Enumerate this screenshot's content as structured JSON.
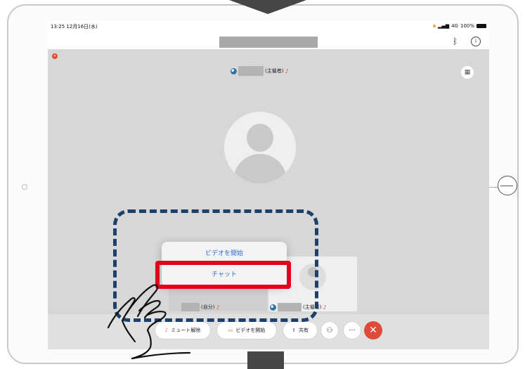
{
  "status_bar": {
    "time": "13:25",
    "date": "12月16日(水)",
    "network": "4G",
    "battery": "100%"
  },
  "top_bar": {
    "bluetooth_icon": "bluetooth-icon",
    "info_icon": "info-icon"
  },
  "host_top": {
    "role": "(主催者)"
  },
  "self_thumb": {
    "role": "(自分)"
  },
  "other_thumb": {
    "role": "(主催者)"
  },
  "toolbar": {
    "unmute_label": "ミュート解除",
    "start_video_label": "ビデオを開始",
    "share_label": "共有",
    "participants_icon": "person-icon",
    "more_icon": "ellipsis-icon",
    "end_icon": "close-icon"
  },
  "popup_menu": {
    "items": [
      {
        "label": "ビデオを開始"
      },
      {
        "label": "チャット"
      }
    ]
  },
  "colors": {
    "highlight_red": "#e1041a",
    "dashed_blue": "#1c3f6b",
    "end_button": "#e04a3a",
    "menu_text": "#2f6ed2"
  }
}
